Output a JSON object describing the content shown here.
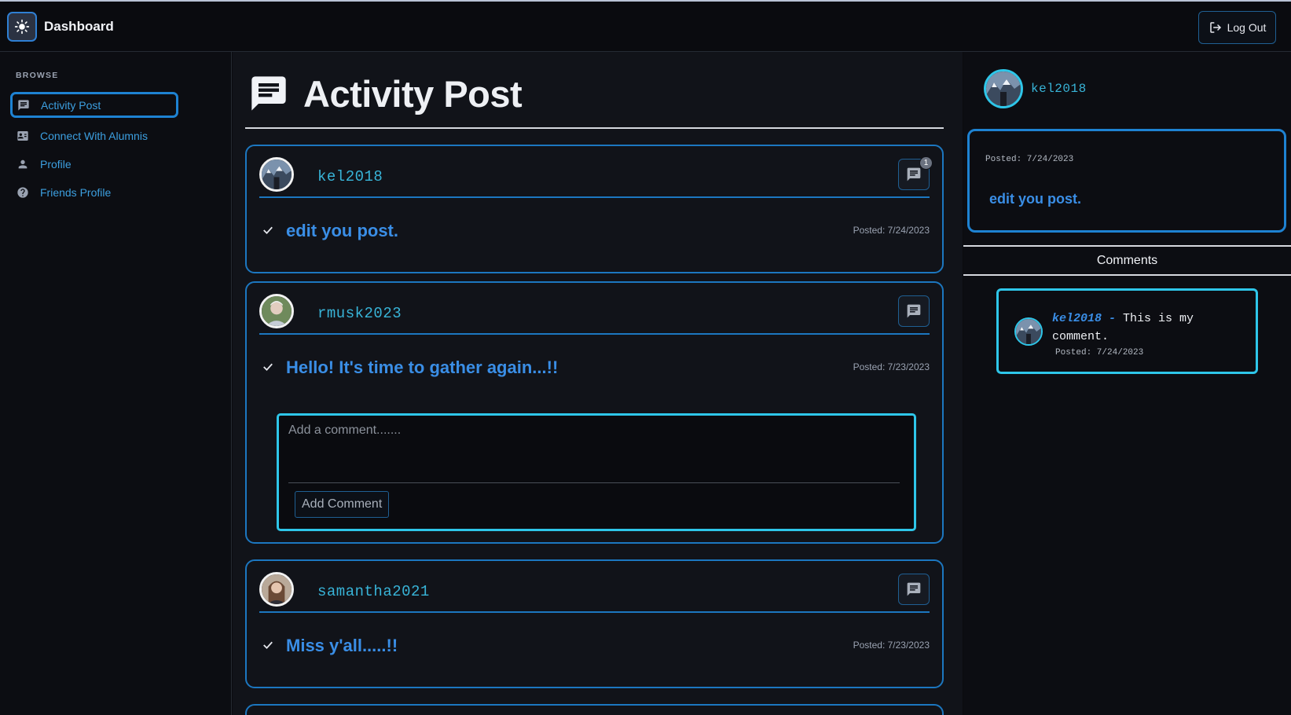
{
  "header": {
    "title": "Dashboard",
    "logout_label": "Log Out"
  },
  "sidebar": {
    "section_label": "BROWSE",
    "items": [
      {
        "label": "Activity Post",
        "icon": "chat-icon",
        "active": true
      },
      {
        "label": "Connect With Alumnis",
        "icon": "contact-card-icon",
        "active": false
      },
      {
        "label": "Profile",
        "icon": "person-icon",
        "active": false
      },
      {
        "label": "Friends Profile",
        "icon": "help-circle-icon",
        "active": false
      }
    ]
  },
  "main": {
    "title": "Activity Post",
    "posts": [
      {
        "username": "kel2018",
        "text": "edit you post.",
        "date": "Posted: 7/24/2023",
        "comment_count": "1"
      },
      {
        "username": "rmusk2023",
        "text": "Hello! It's time to gather again...!!",
        "date": "Posted: 7/23/2023"
      },
      {
        "username": "samantha2021",
        "text": "Miss y'all.....!!",
        "date": "Posted: 7/23/2023"
      }
    ],
    "comment_form": {
      "placeholder": "Add a comment.......",
      "button_label": "Add Comment"
    }
  },
  "detail": {
    "username": "kel2018",
    "posted": "Posted: 7/24/2023",
    "text": "edit you post.",
    "comments_title": "Comments",
    "comments": [
      {
        "username": "kel2018",
        "separator": " - ",
        "text": "This is my comment.",
        "date": "Posted: 7/24/2023"
      }
    ]
  },
  "colors": {
    "accent": "#1e82d2",
    "cyan": "#2ec6e9",
    "link": "#3a8ee6",
    "background": "#0a0b0f"
  }
}
